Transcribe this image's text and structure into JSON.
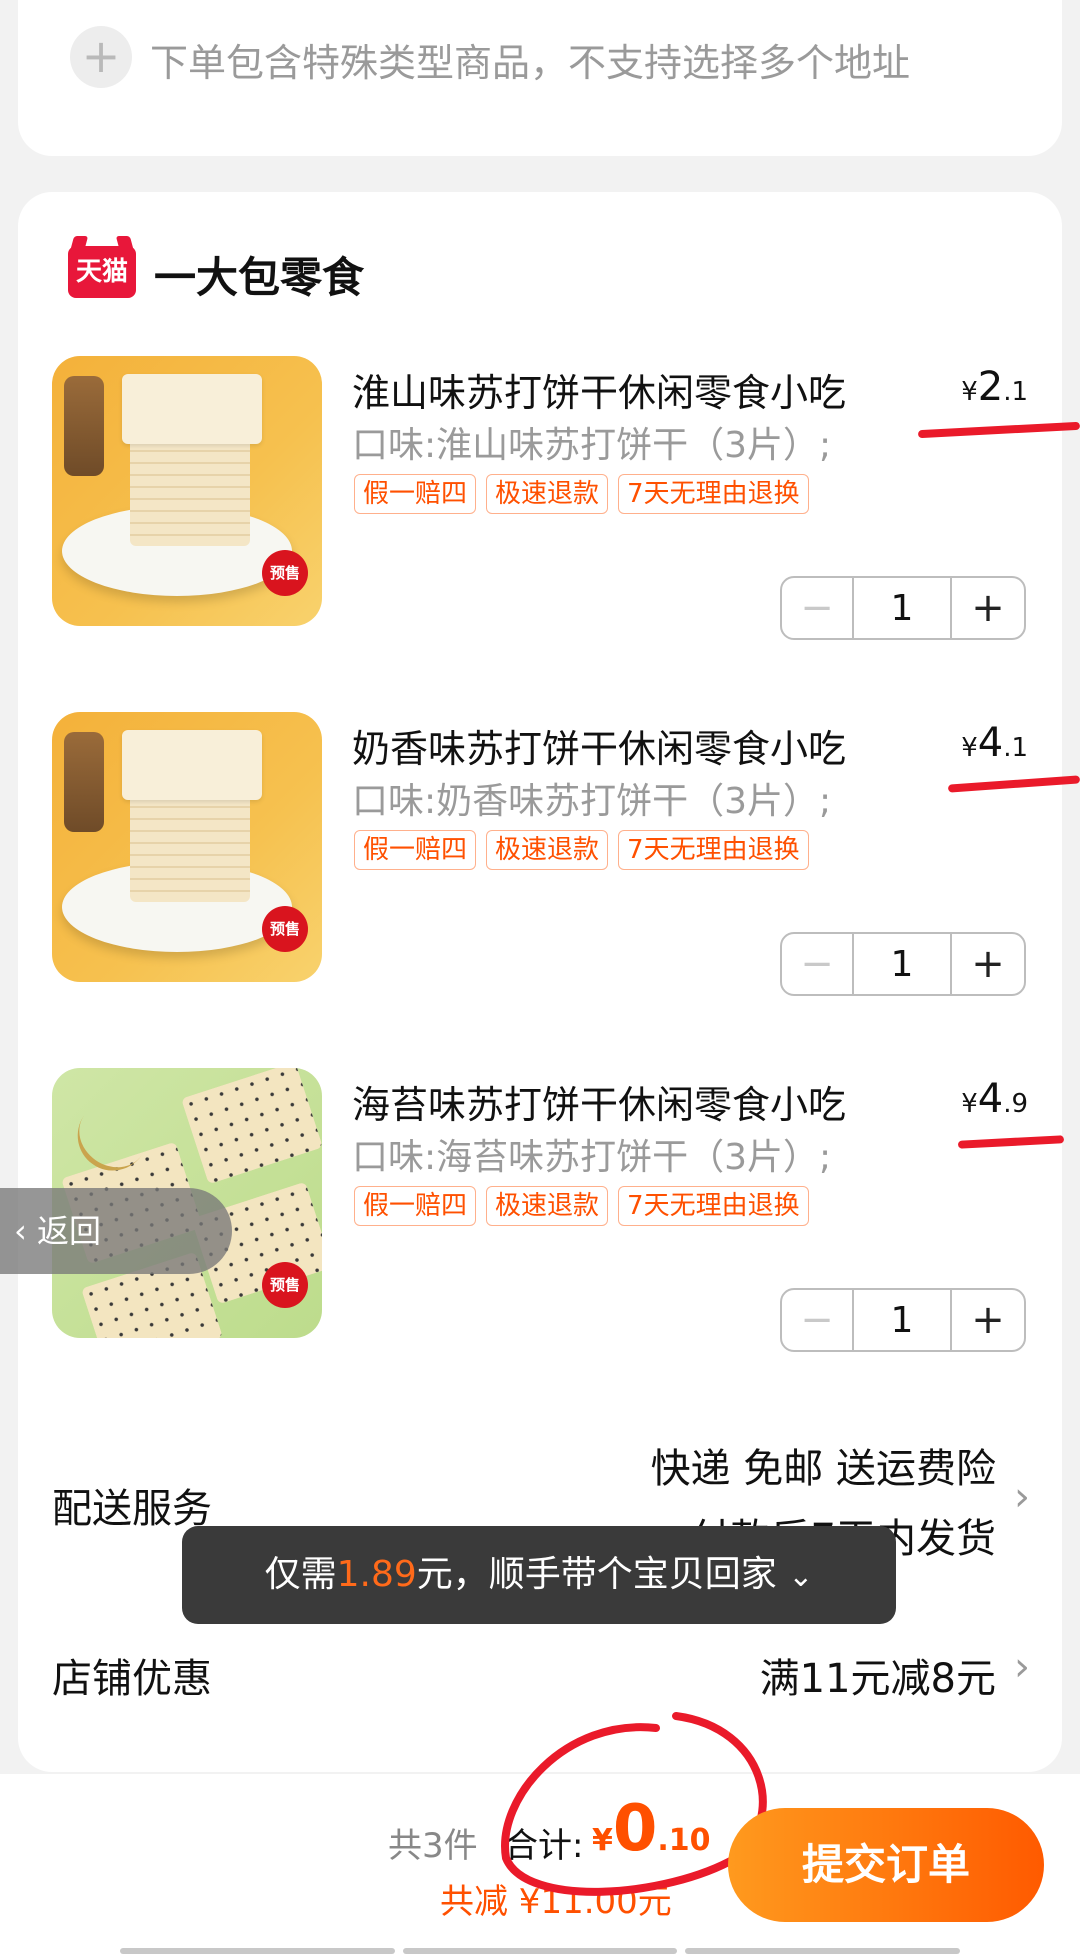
{
  "address": {
    "notice": "下单包含特殊类型商品，不支持选择多个地址"
  },
  "store": {
    "logo_text": "天猫",
    "name": "一大包零食"
  },
  "items": [
    {
      "title": "淮山味苏打饼干休闲零食小吃",
      "spec": "口味:淮山味苏打饼干（3片）;",
      "tags": [
        "假一赔四",
        "极速退款",
        "7天无理由退换"
      ],
      "price_symbol": "¥",
      "price_int": "2",
      "price_dec": ".1",
      "quantity": "1",
      "badge": "预售"
    },
    {
      "title": "奶香味苏打饼干休闲零食小吃",
      "spec": "口味:奶香味苏打饼干（3片）;",
      "tags": [
        "假一赔四",
        "极速退款",
        "7天无理由退换"
      ],
      "price_symbol": "¥",
      "price_int": "4",
      "price_dec": ".1",
      "quantity": "1",
      "badge": "预售"
    },
    {
      "title": "海苔味苏打饼干休闲零食小吃",
      "spec": "口味:海苔味苏打饼干（3片）;",
      "tags": [
        "假一赔四",
        "极速退款",
        "7天无理由退换"
      ],
      "price_symbol": "¥",
      "price_int": "4",
      "price_dec": ".9",
      "quantity": "1",
      "badge": "预售"
    }
  ],
  "stepper": {
    "minus": "−",
    "plus": "+"
  },
  "delivery": {
    "label": "配送服务",
    "line1": "快递 免邮 送运费险",
    "line2": "付款后7天内发货"
  },
  "coupon": {
    "label": "店铺优惠",
    "value": "满11元减8元"
  },
  "back": {
    "label": "返回"
  },
  "toast": {
    "prefix": "仅需",
    "amount": "1.89",
    "suffix": "元，顺手带个宝贝回家"
  },
  "footer": {
    "count": "共3件",
    "total_label": "合计:",
    "total_symbol": "¥",
    "total_int": "0",
    "total_dec": ".10",
    "discount": "共减 ¥11.00元",
    "submit": "提交订单"
  },
  "colors": {
    "accent": "#ff5000",
    "tmall_red": "#e8173a",
    "annotation_red": "#ea1a2a"
  }
}
